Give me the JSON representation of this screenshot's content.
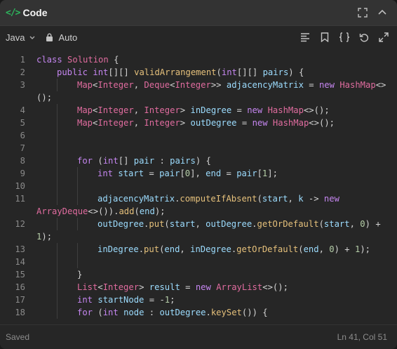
{
  "window": {
    "title": "Code"
  },
  "toolbar": {
    "language": "Java",
    "mode": "Auto"
  },
  "footer": {
    "status": "Saved",
    "cursor": "Ln 41, Col 51"
  },
  "code_lines": [
    {
      "n": "1",
      "indent": 0,
      "text": "class Solution {"
    },
    {
      "n": "2",
      "indent": 1,
      "text": "public int[][] validArrangement(int[][] pairs) {"
    },
    {
      "n": "3",
      "indent": 2,
      "text": "Map<Integer, Deque<Integer>> adjacencyMatrix = new HashMap<>"
    },
    {
      "n": "",
      "indent": 0,
      "text": "();"
    },
    {
      "n": "4",
      "indent": 2,
      "text": "Map<Integer, Integer> inDegree = new HashMap<>();"
    },
    {
      "n": "5",
      "indent": 2,
      "text": "Map<Integer, Integer> outDegree = new HashMap<>();"
    },
    {
      "n": "6",
      "indent": 2,
      "text": ""
    },
    {
      "n": "7",
      "indent": 2,
      "text": ""
    },
    {
      "n": "8",
      "indent": 2,
      "text": "for (int[] pair : pairs) {"
    },
    {
      "n": "9",
      "indent": 3,
      "text": "int start = pair[0], end = pair[1];"
    },
    {
      "n": "10",
      "indent": 3,
      "text": ""
    },
    {
      "n": "11",
      "indent": 3,
      "text": "adjacencyMatrix.computeIfAbsent(start, k -> new"
    },
    {
      "n": "",
      "indent": 0,
      "text": "ArrayDeque<>()).add(end);"
    },
    {
      "n": "12",
      "indent": 3,
      "text": "outDegree.put(start, outDegree.getOrDefault(start, 0) +"
    },
    {
      "n": "",
      "indent": 0,
      "text": "1);"
    },
    {
      "n": "13",
      "indent": 3,
      "text": "inDegree.put(end, inDegree.getOrDefault(end, 0) + 1);"
    },
    {
      "n": "14",
      "indent": 3,
      "text": ""
    },
    {
      "n": "15",
      "indent": 2,
      "text": "}"
    },
    {
      "n": "16",
      "indent": 2,
      "text": "List<Integer> result = new ArrayList<>();"
    },
    {
      "n": "17",
      "indent": 2,
      "text": "int startNode = -1;"
    },
    {
      "n": "18",
      "indent": 2,
      "text": "for (int node : outDegree.keySet()) {"
    }
  ],
  "icons": {
    "code": "code-icon",
    "fullscreen": "fullscreen-icon",
    "collapse": "chevron-up-icon",
    "lock": "lock-icon",
    "format": "format-lines-icon",
    "bookmark": "bookmark-icon",
    "braces": "braces-icon",
    "reset": "undo-icon",
    "expand": "expand-icon"
  },
  "colors": {
    "accent": "#2db55d",
    "keyword": "#c586f0",
    "type": "#e06c9f",
    "builtin": "#569cd6",
    "function": "#e5c07b",
    "variable": "#9cdcfe"
  }
}
